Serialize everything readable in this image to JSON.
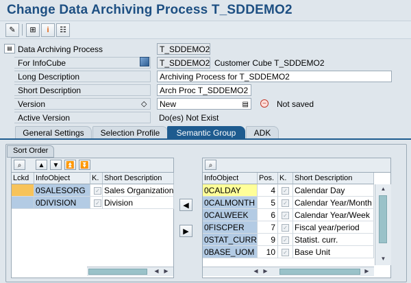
{
  "title": "Change Data Archiving Process T_SDDEMO2",
  "toolbar": {
    "icons": [
      "pencil-glasses-icon",
      "hierarchy-icon",
      "info-icon",
      "structure-icon"
    ]
  },
  "form": {
    "header_label": "Data Archiving Process",
    "header_value": "T_SDDEMO2",
    "infocube_label": "For InfoCube",
    "infocube_value": "T_SDDEMO2",
    "infocube_desc": "Customer Cube T_SDDEMO2",
    "long_desc_label": "Long Description",
    "long_desc_value": "Archiving Process for T_SDDEMO2",
    "short_desc_label": "Short Description",
    "short_desc_value": "Arch Proc T_SDDEMO2",
    "version_label": "Version",
    "version_value": "New",
    "version_status": "Not saved",
    "active_label": "Active Version",
    "active_value": "Do(es) Not Exist"
  },
  "tabs": [
    {
      "label": "General Settings",
      "active": false
    },
    {
      "label": "Selection Profile",
      "active": false
    },
    {
      "label": "Semantic Group",
      "active": true
    },
    {
      "label": "ADK",
      "active": false
    }
  ],
  "group_title": "Sort Order",
  "left_table": {
    "columns": [
      "Lckd",
      "InfoObject",
      "K.",
      "Short Description"
    ],
    "rows": [
      {
        "infoobject": "0SALESORG",
        "desc": "Sales Organization"
      },
      {
        "infoobject": "0DIVISION",
        "desc": "Division"
      }
    ]
  },
  "right_table": {
    "columns": [
      "InfoObject",
      "Pos.",
      "K.",
      "Short Description"
    ],
    "rows": [
      {
        "infoobject": "0CALDAY",
        "pos": "4",
        "desc": "Calendar Day"
      },
      {
        "infoobject": "0CALMONTH",
        "pos": "5",
        "desc": "Calendar Year/Month"
      },
      {
        "infoobject": "0CALWEEK",
        "pos": "6",
        "desc": "Calendar Year/Week"
      },
      {
        "infoobject": "0FISCPER",
        "pos": "7",
        "desc": "Fiscal year/period"
      },
      {
        "infoobject": "0STAT_CURR",
        "pos": "9",
        "desc": "Statist. curr."
      },
      {
        "infoobject": "0BASE_UOM",
        "pos": "10",
        "desc": "Base Unit"
      }
    ]
  },
  "colors": {
    "title": "#1d4f82",
    "active_tab": "#1e5b8f",
    "selected_row": "#b3cbe4",
    "highlight": "#ffff99"
  }
}
